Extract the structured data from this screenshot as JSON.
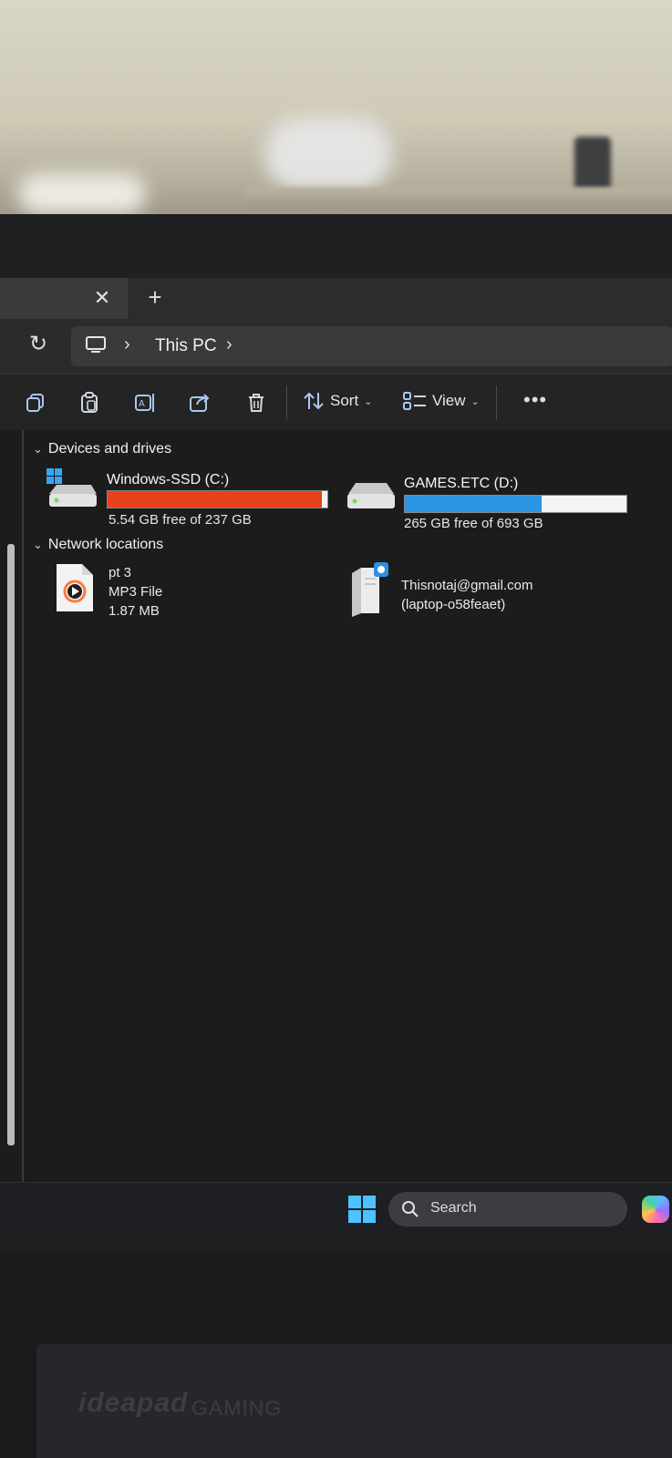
{
  "tabs": {
    "close_glyph": "✕",
    "new_glyph": "+"
  },
  "address_bar": {
    "refresh_glyph": "↻",
    "separator": "›",
    "location": "This PC"
  },
  "toolbar": {
    "sort_label": "Sort",
    "view_label": "View",
    "more_glyph": "•••",
    "chevron": "⌄"
  },
  "sections": {
    "devices": {
      "caret": "⌄",
      "title": "Devices and drives"
    },
    "network": {
      "caret": "⌄",
      "title": "Network locations"
    }
  },
  "drives": [
    {
      "name": "Windows-SSD (C:)",
      "free_text": "5.54 GB free of 237 GB",
      "used_fraction": 0.977,
      "bar_color": "#e8411d"
    },
    {
      "name": "GAMES.ETC (D:)",
      "free_text": "265 GB free of 693 GB",
      "used_fraction": 0.618,
      "bar_color": "#2d95e3"
    }
  ],
  "network_items": [
    {
      "name": "pt 3",
      "type": "MP3 File",
      "size": "1.87 MB",
      "icon": "media-file-icon"
    },
    {
      "line1": "Thisnotaj@gmail.com",
      "line2": "(laptop-o58feaet)",
      "icon": "network-share-icon"
    }
  ],
  "taskbar": {
    "search_label": "Search"
  },
  "device": {
    "brand": "ideapad",
    "brand_sub": "GAMING"
  }
}
